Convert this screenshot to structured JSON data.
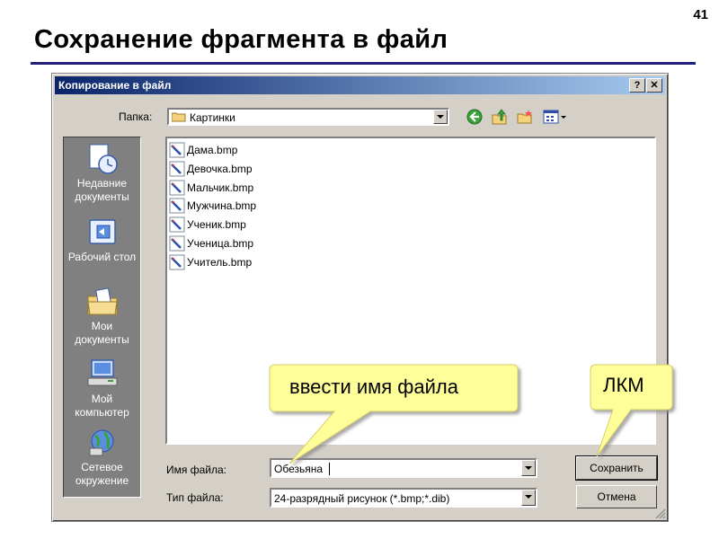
{
  "slide": {
    "number": "41",
    "title": "Сохранение фрагмента в файл"
  },
  "dialog": {
    "title": "Копирование в файл",
    "help_btn": "?",
    "close_btn": "✕",
    "folder_label": "Папка:",
    "folder_value": "Картинки",
    "places": [
      {
        "label": "Недавние документы",
        "icon": "recent-documents-icon"
      },
      {
        "label": "Рабочий стол",
        "icon": "desktop-icon"
      },
      {
        "label": "Мои документы",
        "icon": "my-documents-icon"
      },
      {
        "label": "Мой компьютер",
        "icon": "my-computer-icon"
      },
      {
        "label": "Сетевое окружение",
        "icon": "network-places-icon"
      }
    ],
    "files": [
      "Дама.bmp",
      "Девочка.bmp",
      "Мальчик.bmp",
      "Мужчина.bmp",
      "Ученик.bmp",
      "Ученица.bmp",
      "Учитель.bmp"
    ],
    "filename_label": "Имя файла:",
    "filename_value": "Обезьяна",
    "filetype_label": "Тип файла:",
    "filetype_value": "24-разрядный рисунок (*.bmp;*.dib)",
    "save_button": "Сохранить",
    "cancel_button": "Отмена"
  },
  "callouts": {
    "filename_hint": "ввести имя файла",
    "click_hint": "ЛКМ"
  },
  "colors": {
    "title_rule": "#1f1f7a",
    "dialog_bg": "#d4d0c8",
    "titlebar_start": "#0a246a",
    "titlebar_end": "#a6caf0",
    "places_bg": "#808080",
    "callout_fill": "#ffff99"
  }
}
